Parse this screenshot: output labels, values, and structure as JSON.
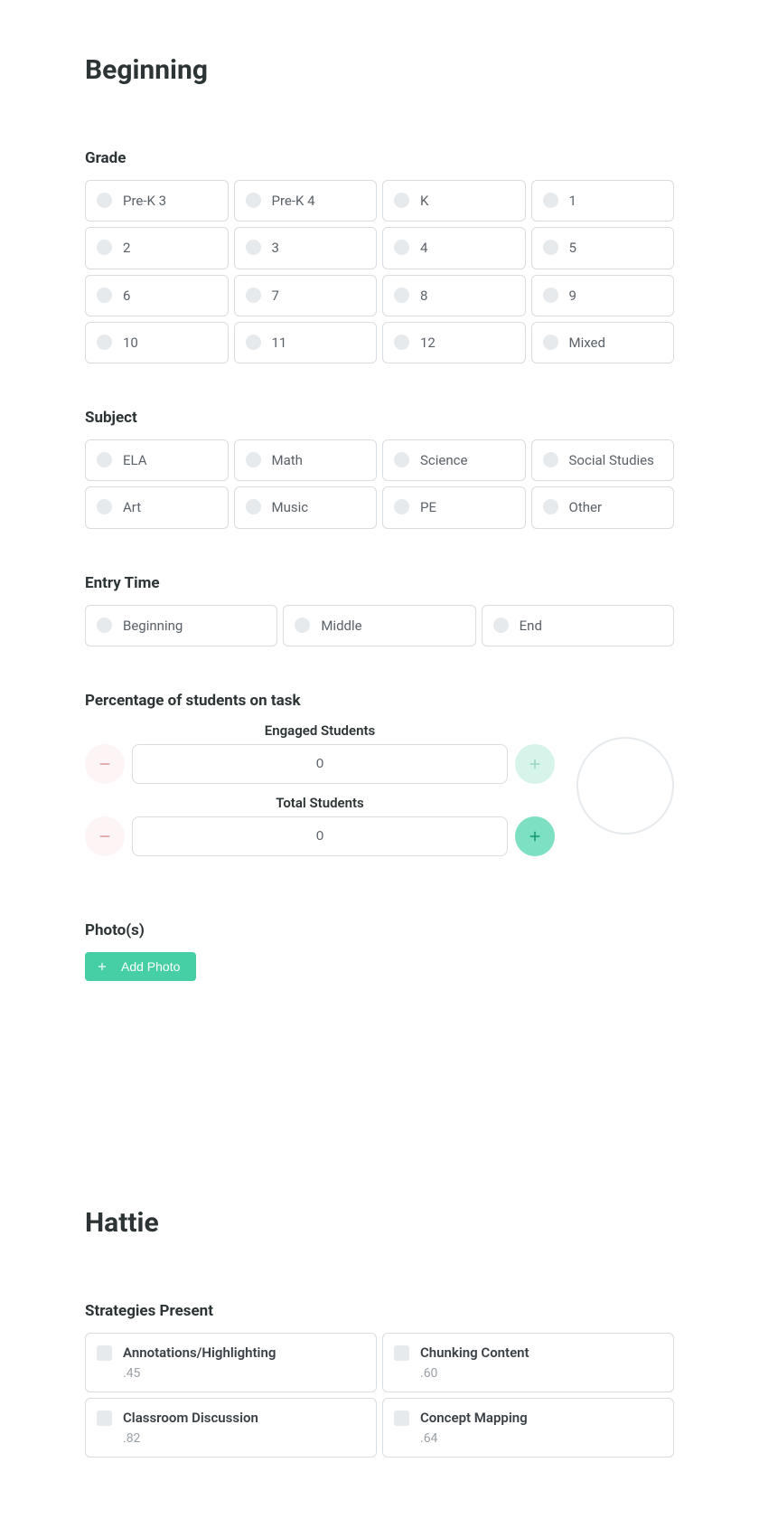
{
  "page_title": "Beginning",
  "grade": {
    "label": "Grade",
    "options": [
      "Pre-K 3",
      "Pre-K 4",
      "K",
      "1",
      "2",
      "3",
      "4",
      "5",
      "6",
      "7",
      "8",
      "9",
      "10",
      "11",
      "12",
      "Mixed"
    ]
  },
  "subject": {
    "label": "Subject",
    "options": [
      "ELA",
      "Math",
      "Science",
      "Social Studies",
      "Art",
      "Music",
      "PE",
      "Other"
    ]
  },
  "entry_time": {
    "label": "Entry Time",
    "options": [
      "Beginning",
      "Middle",
      "End"
    ]
  },
  "percentage": {
    "label": "Percentage of students on task",
    "engaged_label": "Engaged Students",
    "engaged_value": "0",
    "total_label": "Total Students",
    "total_value": "0"
  },
  "photos": {
    "label": "Photo(s)",
    "add_button": "Add Photo"
  },
  "hattie": {
    "title": "Hattie",
    "strategies_label": "Strategies Present",
    "strategies": [
      {
        "name": "Annotations/Highlighting",
        "value": ".45"
      },
      {
        "name": "Chunking Content",
        "value": ".60"
      },
      {
        "name": "Classroom Discussion",
        "value": ".82"
      },
      {
        "name": "Concept Mapping",
        "value": ".64"
      }
    ]
  }
}
